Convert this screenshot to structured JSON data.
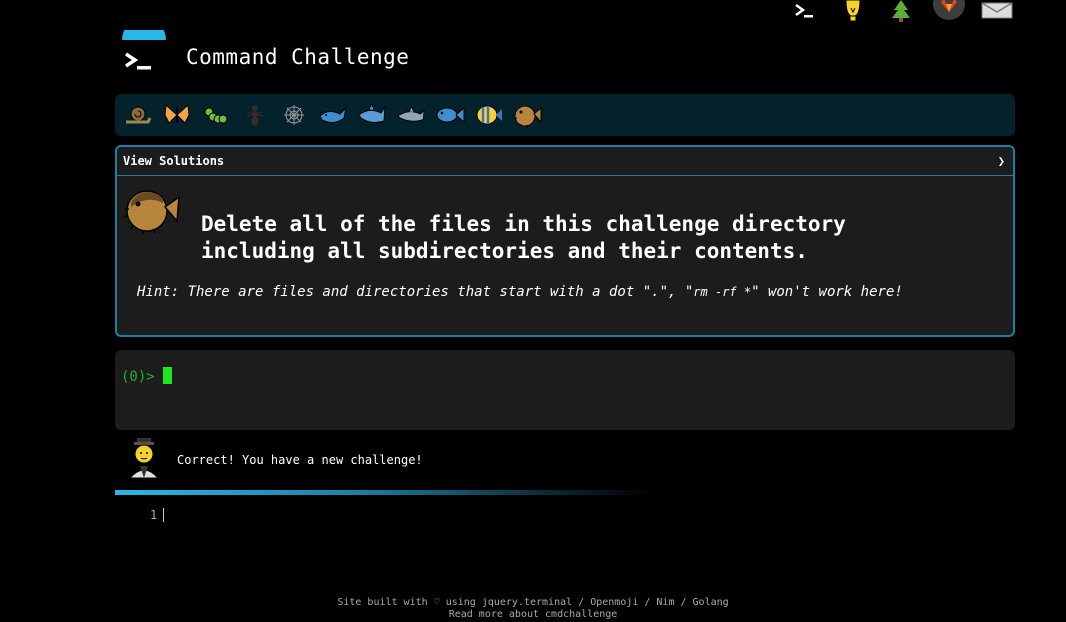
{
  "app": {
    "title": "Command Challenge"
  },
  "top_icons": [
    "terminal-icon",
    "lightbulb-icon",
    "tree-icon",
    "gitlab-icon",
    "envelope-icon"
  ],
  "level_icons": [
    "snail-icon",
    "butterfly-icon",
    "caterpillar-icon",
    "ant-icon",
    "spider-web-icon",
    "whale-icon",
    "shark-icon",
    "dolphin-icon",
    "fish-icon",
    "tropical-fish-icon",
    "blowfish-icon"
  ],
  "challenge": {
    "view_solutions_label": "View Solutions",
    "chevron": "❯",
    "line1": "Delete all of the files in this challenge directory",
    "line2": "including all subdirectories and their contents.",
    "hint_prefix": "Hint: There are files and directories that start with a dot \".\", \"",
    "hint_code": "rm -rf *",
    "hint_suffix": "\" won't work here!"
  },
  "terminal": {
    "prompt": "(0)>"
  },
  "feedback": {
    "message": "Correct! You have a new challenge!"
  },
  "editor": {
    "line_number": "1"
  },
  "footer": {
    "line1": "Site built with ♡ using jquery.terminal / Openmoji / Nim / Golang",
    "line2": "Read more about cmdchallenge"
  },
  "colors": {
    "accent": "#1a7fa1",
    "prompt": "#22b422",
    "cursor": "#1ee61e",
    "panel": "#1c1c1c",
    "bar": "#03222c"
  }
}
